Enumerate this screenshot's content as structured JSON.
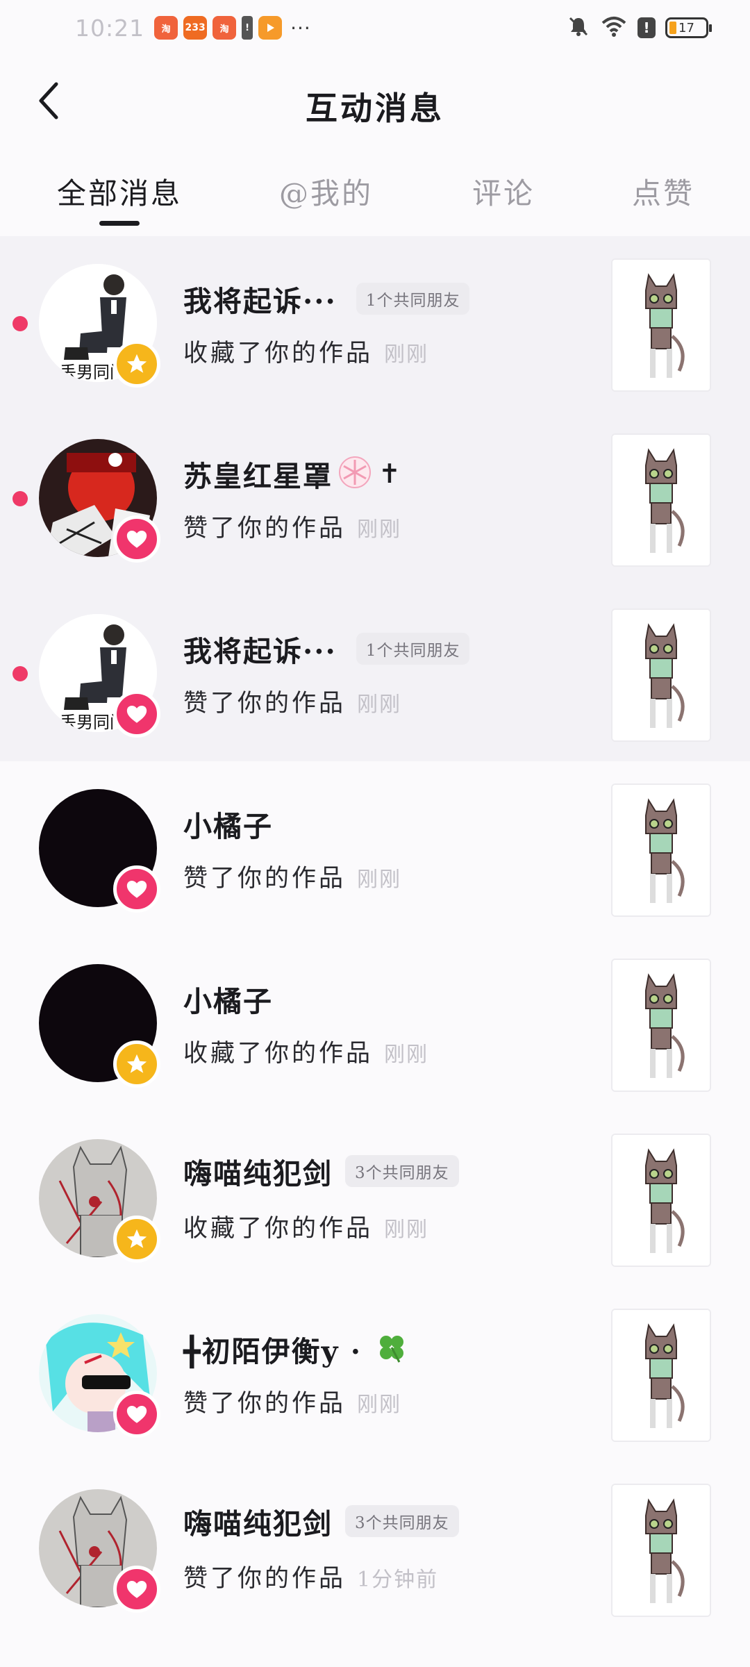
{
  "status_bar": {
    "time": "10:21",
    "app_icons": [
      "taobao-icon",
      "app-233-icon",
      "taobao-icon",
      "alert-icon",
      "video-play-icon"
    ],
    "app_233_label": "233",
    "more": "···",
    "battery": "17"
  },
  "header": {
    "title": "互动消息"
  },
  "tabs": [
    {
      "label": "全部消息",
      "active": true
    },
    {
      "label": "@我的",
      "active": false
    },
    {
      "label": "评论",
      "active": false
    },
    {
      "label": "点赞",
      "active": false
    }
  ],
  "colors": {
    "like_badge": "#f0356c",
    "fav_badge": "#f6b61b",
    "unread_dot": "#ef3a67",
    "unread_bg": "#f3f2f6"
  },
  "messages": [
    {
      "name": "我将起诉···",
      "mutual": "1个共同朋友",
      "action": "收藏了你的作品",
      "time": "刚刚",
      "badge": "star-icon",
      "unread": true,
      "avatar": "kneeling-man-avatar",
      "avatar_caption": "丢男同门"
    },
    {
      "name": "苏皇红星罩",
      "mutual": "",
      "action": "赞了你的作品",
      "time": "刚刚",
      "badge": "heart-icon",
      "unread": true,
      "avatar": "red-anime-avatar"
    },
    {
      "name": "我将起诉···",
      "mutual": "1个共同朋友",
      "action": "赞了你的作品",
      "time": "刚刚",
      "badge": "heart-icon",
      "unread": true,
      "avatar": "kneeling-man-avatar",
      "avatar_caption": "丢男同门"
    },
    {
      "name": "小橘子",
      "mutual": "",
      "action": "赞了你的作品",
      "time": "刚刚",
      "badge": "heart-icon",
      "unread": false,
      "avatar": "black-avatar"
    },
    {
      "name": "小橘子",
      "mutual": "",
      "action": "收藏了你的作品",
      "time": "刚刚",
      "badge": "star-icon",
      "unread": false,
      "avatar": "black-avatar"
    },
    {
      "name": "嗨喵纯犯剑",
      "mutual": "3个共同朋友",
      "action": "收藏了你的作品",
      "time": "刚刚",
      "badge": "star-icon",
      "unread": false,
      "avatar": "sketch-cat-avatar"
    },
    {
      "name": "╋初陌伊衡y ·",
      "mutual": "",
      "action": "赞了你的作品",
      "time": "刚刚",
      "badge": "heart-icon",
      "unread": false,
      "avatar": "cyan-anime-avatar"
    },
    {
      "name": "嗨喵纯犯剑",
      "mutual": "3个共同朋友",
      "action": "赞了你的作品",
      "time": "1分钟前",
      "badge": "heart-icon",
      "unread": false,
      "avatar": "sketch-cat-avatar"
    }
  ]
}
